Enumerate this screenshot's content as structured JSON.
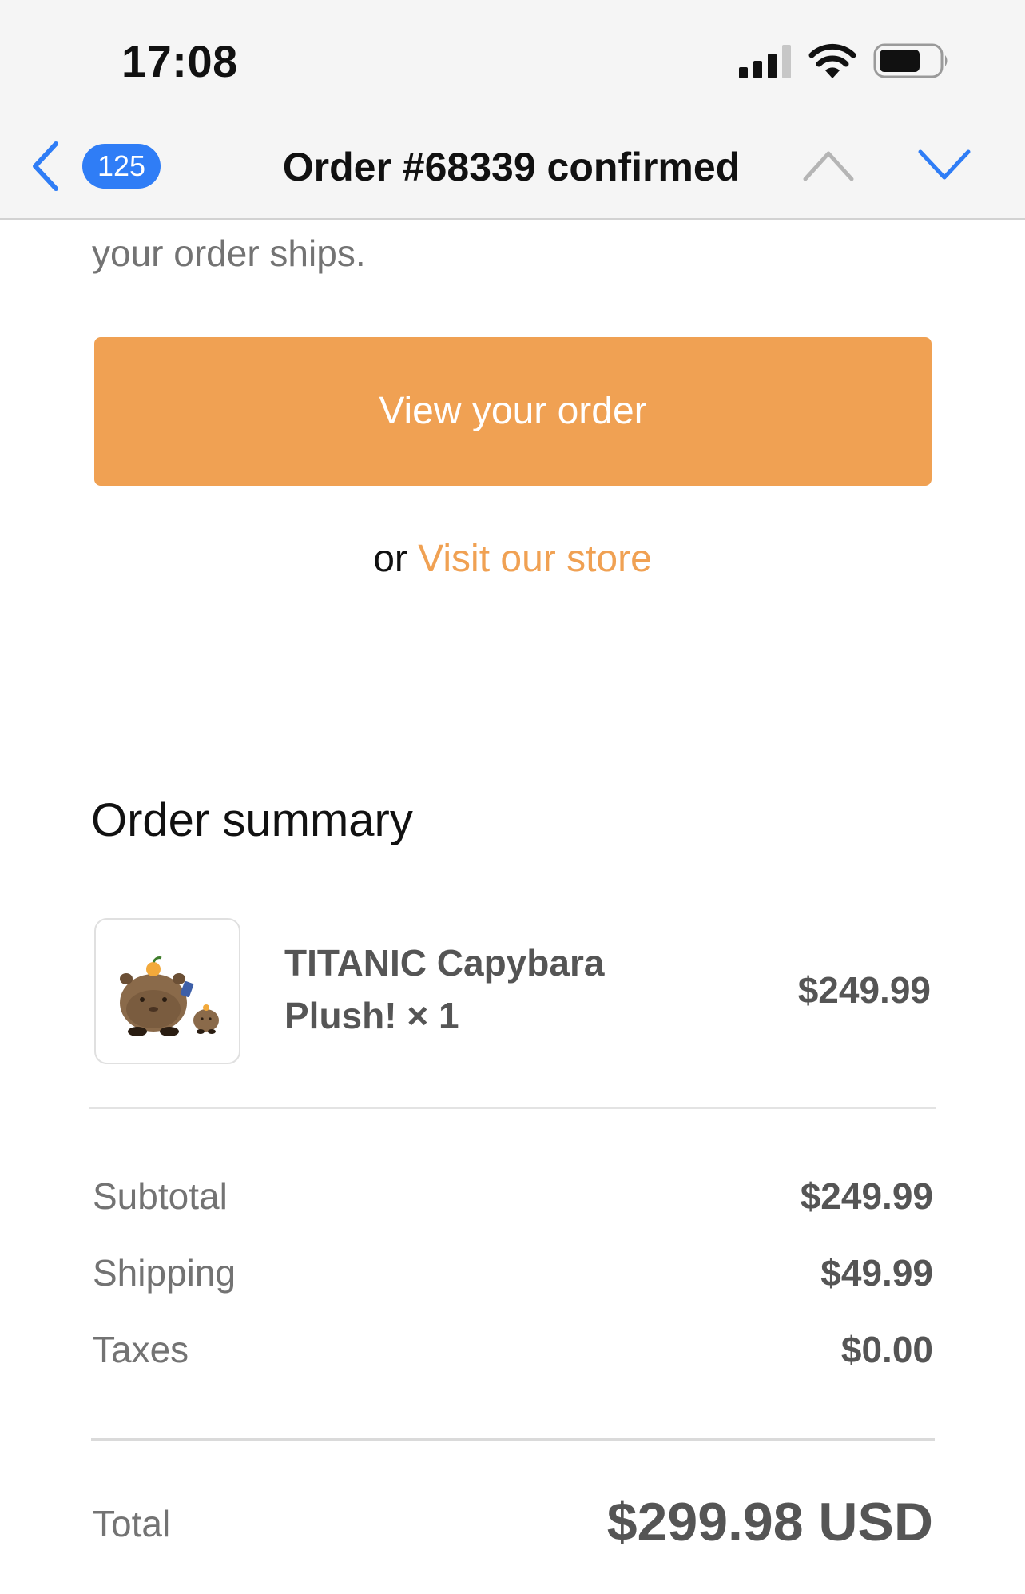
{
  "status_bar": {
    "time": "17:08",
    "signal_icon": "cellular-signal-icon",
    "wifi_icon": "wifi-icon",
    "battery_icon": "battery-icon"
  },
  "nav": {
    "back_icon": "chevron-left-icon",
    "unread_count": "125",
    "title": "Order #68339 confirmed",
    "prev_icon": "chevron-up-icon",
    "next_icon": "chevron-down-icon"
  },
  "email": {
    "intro_tail": "your order ships.",
    "view_order_button": "View your order",
    "alt_prefix": "or",
    "visit_store_link": "Visit our store",
    "accent_color": "#f0a153"
  },
  "summary": {
    "title": "Order summary",
    "items": [
      {
        "image_icon": "capybara-plush-image",
        "name": "TITANIC Capybara Plush! × 1",
        "price": "$249.99"
      }
    ],
    "lines": [
      {
        "label": "Subtotal",
        "value": "$249.99"
      },
      {
        "label": "Shipping",
        "value": "$49.99"
      },
      {
        "label": "Taxes",
        "value": "$0.00"
      }
    ],
    "total_label": "Total",
    "total_value": "$299.98 USD"
  }
}
